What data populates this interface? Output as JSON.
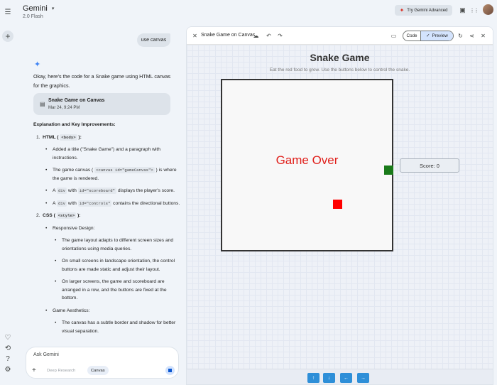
{
  "header": {
    "app_name": "Gemini",
    "model": "2.0 Flash",
    "try_advanced": "Try Gemini Advanced"
  },
  "chat": {
    "user_message": "use canvas",
    "response_intro": "Okay, here's the code for a Snake game using HTML canvas for the graphics.",
    "card": {
      "title": "Snake Game on Canvas",
      "date": "Mar 24, 9:24 PM"
    },
    "section_heading": "Explanation and Key Improvements:",
    "html_label": "HTML (",
    "html_code": "<body>",
    "html_label_end": "):",
    "html_bullets": {
      "b1": "Added a title (\"Snake Game\") and a paragraph with instructions.",
      "b2_pre": "The game canvas (",
      "b2_code": "<canvas id=\"gameCanvas\">",
      "b2_post": ") is where the game is rendered.",
      "b3_pre": "A",
      "b3_code1": "div",
      "b3_mid": "with",
      "b3_code2": "id=\"scoreboard\"",
      "b3_post": "displays the player's score.",
      "b4_pre": "A",
      "b4_code1": "div",
      "b4_mid": "with",
      "b4_code2": "id=\"controls\"",
      "b4_post": "contains the directional buttons."
    },
    "css_label": "CSS (",
    "css_code": "<style>",
    "css_label_end": "):",
    "css_bullets": {
      "responsive": "Responsive Design:",
      "r1": "The game layout adapts to different screen sizes and orientations using media queries.",
      "r2": "On small screens in landscape orientation, the control buttons are made static and adjust their layout.",
      "r3": "On larger screens, the game and scoreboard are arranged in a row, and the buttons are fixed at the bottom.",
      "aesthetics": "Game Aesthetics:",
      "a1": "The canvas has a subtle border and shadow for better visual separation."
    },
    "input_placeholder": "Ask Gemini",
    "chip_deep_research": "Deep Research",
    "chip_canvas": "Canvas"
  },
  "panel": {
    "title": "Snake Game on Canvas",
    "code_tab": "Code",
    "preview_tab": "Preview",
    "preview_check": "✓",
    "game": {
      "title": "Snake Game",
      "subtitle": "Eat the red food to grow. Use the buttons below to control the snake.",
      "status": "Game Over",
      "score": "Score: 0"
    },
    "controls": {
      "up": "↑",
      "down": "↓",
      "left": "←",
      "right": "→"
    }
  },
  "colors": {
    "food": "#ff0000",
    "snake": "#1a7a1a",
    "game_over": "#e0201b",
    "control_button": "#2e8fd8",
    "preview_active": "#d3e3fd"
  },
  "icons": {
    "menu": "☰",
    "plus": "+",
    "caret": "▾",
    "spark": "✦",
    "gem": "✦",
    "card": "▤",
    "briefcase": "▣",
    "apps": "⋮⋮",
    "close": "✕",
    "cloud": "☁",
    "undo": "↶",
    "redo": "↷",
    "layout": "▭",
    "refresh": "↻",
    "share": "⋖",
    "help": "?",
    "history": "⟲",
    "settings": "⚙",
    "heart": "♡"
  }
}
